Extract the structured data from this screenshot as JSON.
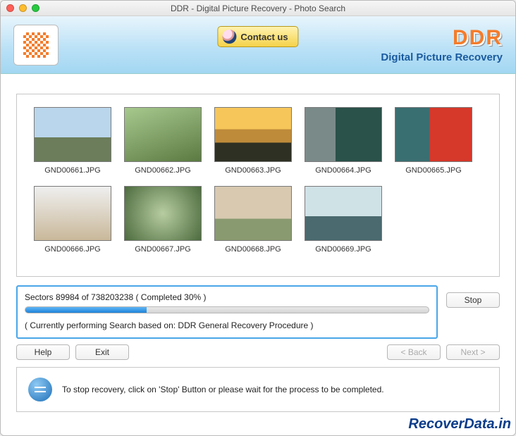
{
  "window": {
    "title": "DDR - Digital Picture Recovery - Photo Search"
  },
  "header": {
    "contact_label": "Contact us",
    "brand": "DDR",
    "brand_sub": "Digital Picture Recovery"
  },
  "thumbs": [
    {
      "name": "GND00661.JPG"
    },
    {
      "name": "GND00662.JPG"
    },
    {
      "name": "GND00663.JPG"
    },
    {
      "name": "GND00664.JPG"
    },
    {
      "name": "GND00665.JPG"
    },
    {
      "name": "GND00666.JPG"
    },
    {
      "name": "GND00667.JPG"
    },
    {
      "name": "GND00668.JPG"
    },
    {
      "name": "GND00669.JPG"
    }
  ],
  "progress": {
    "sectors_current": 89984,
    "sectors_total": 738203238,
    "percent": 30,
    "status_line": "Sectors 89984 of 738203238    ( Completed 30% )",
    "procedure_line": "( Currently performing Search based on: DDR General Recovery Procedure )"
  },
  "buttons": {
    "stop": "Stop",
    "help": "Help",
    "exit": "Exit",
    "back": "< Back",
    "next": "Next >"
  },
  "tip": "To stop recovery, click on 'Stop' Button or please wait for the process to be completed.",
  "watermark": "RecoverData.in"
}
